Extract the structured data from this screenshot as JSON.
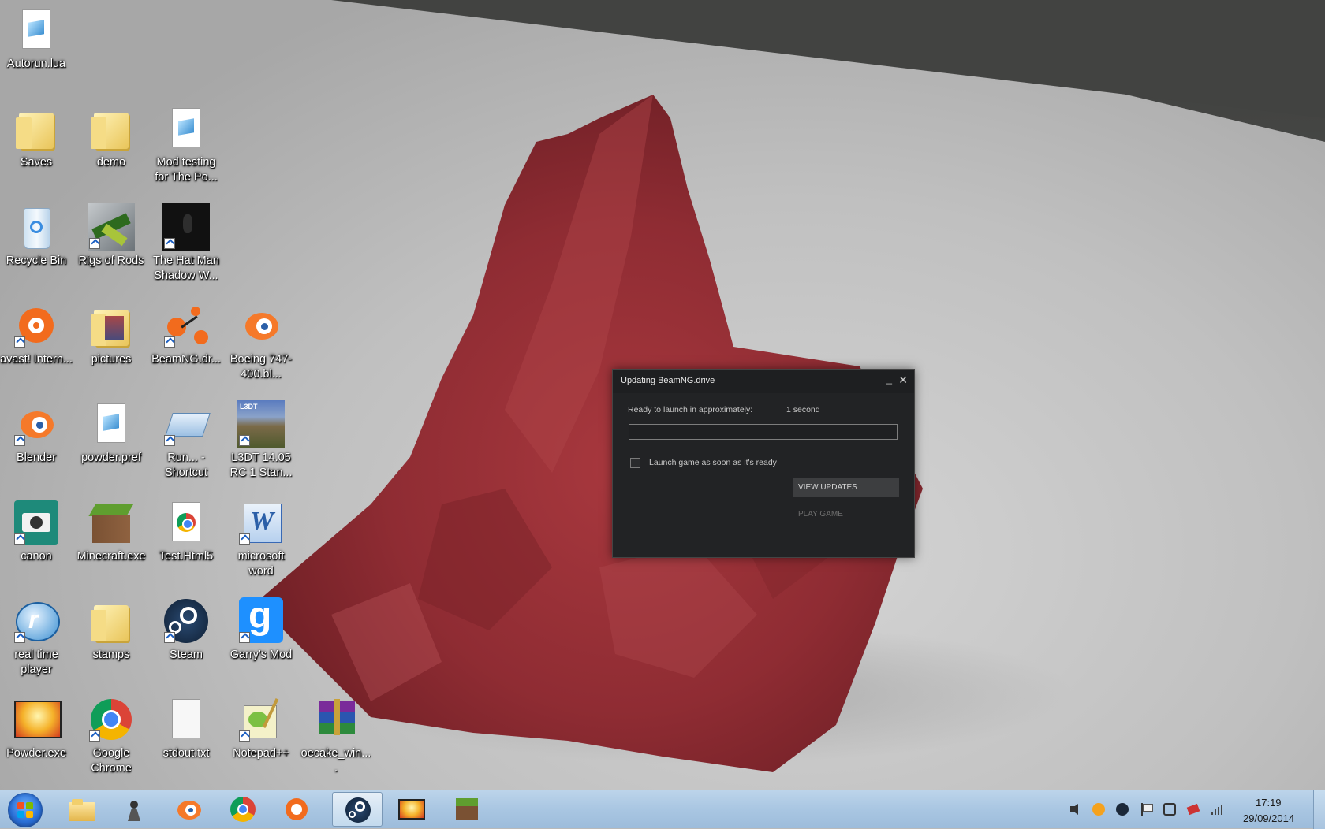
{
  "desktop": {
    "icons": [
      {
        "label": "Autorun.lua",
        "icon": "lua-file-icon"
      },
      {
        "label": "Saves",
        "icon": "folder-icon"
      },
      {
        "label": "demo",
        "icon": "folder-icon"
      },
      {
        "label": "Mod testing for The Po...",
        "icon": "document-icon"
      },
      {
        "label": "Recycle Bin",
        "icon": "recycle-bin-icon"
      },
      {
        "label": "Rigs of Rods",
        "icon": "rigs-of-rods-icon"
      },
      {
        "label": "The Hat Man Shadow W...",
        "icon": "hat-man-icon"
      },
      {
        "label": "avast! Intern...",
        "icon": "avast-icon"
      },
      {
        "label": "pictures",
        "icon": "folder-icon"
      },
      {
        "label": "BeamNG.dr...",
        "icon": "beamng-icon"
      },
      {
        "label": "Boeing 747-400.bl...",
        "icon": "blender-file-icon"
      },
      {
        "label": "Blender",
        "icon": "blender-icon"
      },
      {
        "label": "powder.pref",
        "icon": "document-icon"
      },
      {
        "label": "Run... - Shortcut",
        "icon": "run-icon"
      },
      {
        "label": "L3DT 14.05 RC 1 Stan...",
        "icon": "l3dt-icon"
      },
      {
        "label": "canon",
        "icon": "camera-icon"
      },
      {
        "label": "Minecraft.exe",
        "icon": "minecraft-icon"
      },
      {
        "label": "Test.Html5",
        "icon": "chrome-html-icon"
      },
      {
        "label": "microsoft word",
        "icon": "word-icon"
      },
      {
        "label": "real time player",
        "icon": "realplayer-icon"
      },
      {
        "label": "stamps",
        "icon": "folder-icon"
      },
      {
        "label": "Steam",
        "icon": "steam-icon"
      },
      {
        "label": "Garry's Mod",
        "icon": "garrys-mod-icon"
      },
      {
        "label": "Powder.exe",
        "icon": "powder-icon"
      },
      {
        "label": "Google Chrome",
        "icon": "chrome-icon"
      },
      {
        "label": "stdout.txt",
        "icon": "text-file-icon"
      },
      {
        "label": "Notepad++",
        "icon": "notepadpp-icon"
      },
      {
        "label": "oecake_win....",
        "icon": "winrar-archive-icon"
      }
    ]
  },
  "dialog": {
    "title": "Updating BeamNG.drive",
    "minimize": "_",
    "close": "✕",
    "ready_label": "Ready to launch in approximately:",
    "ready_time": "1 second",
    "progress": 0,
    "launch_checkbox_label": "Launch game as soon as it's ready",
    "launch_checked": false,
    "view_updates": "VIEW UPDATES",
    "play_game": "PLAY GAME"
  },
  "taskbar": {
    "start": "windows-start-icon",
    "pinned": [
      {
        "icon": "explorer-icon",
        "active": false
      },
      {
        "icon": "chess-icon",
        "active": false
      },
      {
        "icon": "blender-icon",
        "active": false
      },
      {
        "icon": "chrome-icon",
        "active": false
      },
      {
        "icon": "avast-icon",
        "active": false
      },
      {
        "icon": "steam-icon",
        "active": true
      },
      {
        "icon": "powder-icon",
        "active": false
      },
      {
        "icon": "minecraft-icon",
        "active": false
      }
    ],
    "tray": [
      "volume-icon",
      "avast-tray-icon",
      "steam-tray-icon",
      "action-center-flag-icon",
      "network-hub-icon",
      "bluetooth-icon",
      "signal-icon"
    ],
    "clock": {
      "time": "17:19",
      "date": "29/09/2014"
    }
  },
  "colors": {
    "dialog_bg": "#222325",
    "taskbar": "#a9c6e2",
    "volcano": "#9c2f35"
  }
}
